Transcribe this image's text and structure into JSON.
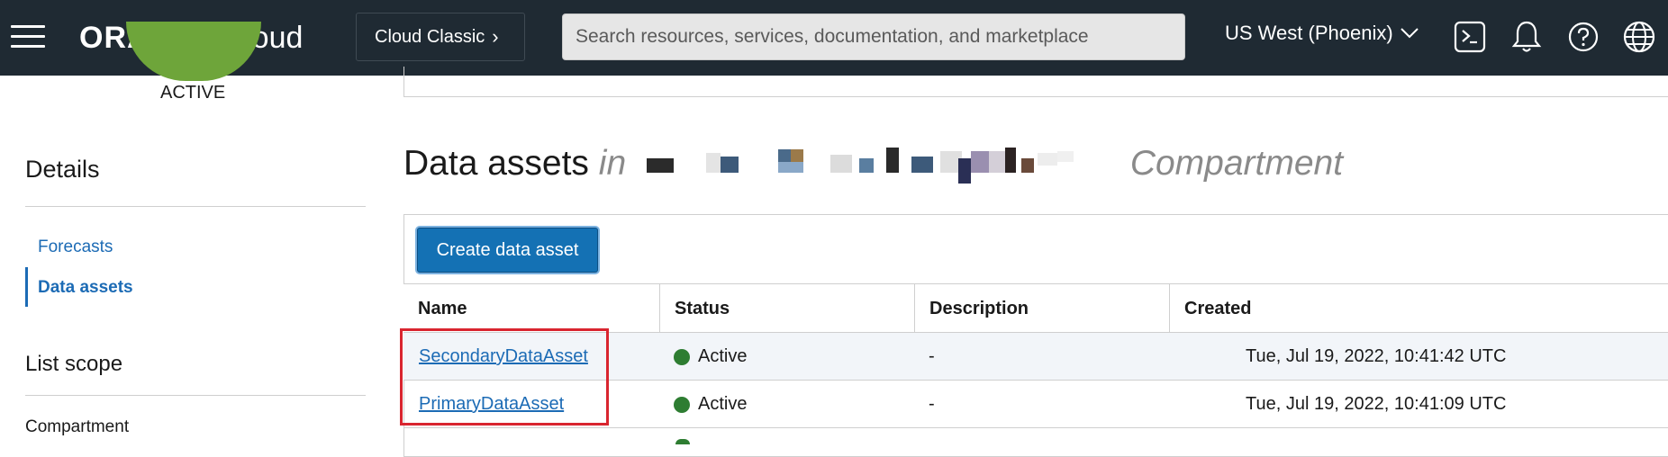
{
  "header": {
    "logo_brand": "ORACLE",
    "logo_product": "Cloud",
    "classic_label": "Cloud Classic",
    "classic_chevron": "›",
    "search_placeholder": "Search resources, services, documentation, and marketplace",
    "region": "US West (Phoenix)",
    "icons": [
      "hamburger-menu-icon",
      "cloud-shell-icon",
      "notifications-bell-icon",
      "help-icon",
      "language-globe-icon"
    ]
  },
  "left_panel": {
    "status": "ACTIVE",
    "status_color": "#6ea53a",
    "details_heading": "Details",
    "nav_items": [
      {
        "label": "Forecasts",
        "active": false
      },
      {
        "label": "Data assets",
        "active": true
      }
    ],
    "list_scope_heading": "List scope",
    "compartment_label": "Compartment"
  },
  "main": {
    "title": "Data assets",
    "title_in": "in",
    "title_compartment": "Compartment",
    "create_button": "Create data asset",
    "columns": [
      "Name",
      "Status",
      "Description",
      "Created"
    ],
    "rows": [
      {
        "name": "SecondaryDataAsset",
        "status": "Active",
        "description": "-",
        "created": "Tue, Jul 19, 2022, 10:41:42 UTC"
      },
      {
        "name": "PrimaryDataAsset",
        "status": "Active",
        "description": "-",
        "created": "Tue, Jul 19, 2022, 10:41:09 UTC"
      }
    ],
    "colors": {
      "accent": "#1471b4",
      "link": "#1c6bb5",
      "active_status": "#2e7d32",
      "highlight": "#d9252f"
    }
  }
}
